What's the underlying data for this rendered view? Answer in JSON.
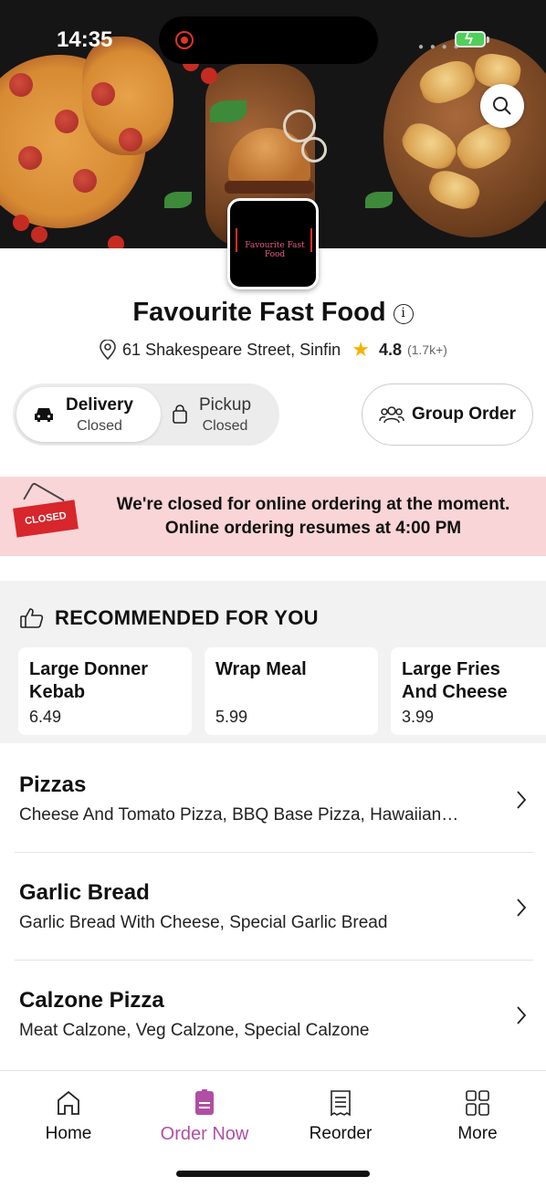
{
  "status_bar": {
    "time": "14:35"
  },
  "store": {
    "name": "Favourite Fast Food",
    "logo_text": "Favourite Fast Food",
    "address": "61 Shakespeare Street, Sinfin",
    "rating": "4.8",
    "rating_count": "(1.7k+)"
  },
  "modes": {
    "delivery": {
      "label": "Delivery",
      "status": "Closed"
    },
    "pickup": {
      "label": "Pickup",
      "status": "Closed"
    }
  },
  "group_order": {
    "label": "Group Order"
  },
  "closed_banner": {
    "sign_text": "CLOSED",
    "line1": "We're closed for online ordering at the moment.",
    "line2": "Online ordering resumes at 4:00 PM"
  },
  "recommended": {
    "title": "RECOMMENDED FOR YOU",
    "items": [
      {
        "name": "Large Donner Kebab",
        "price": "6.49"
      },
      {
        "name": "Wrap Meal",
        "price": "5.99"
      },
      {
        "name": "Large Fries And Cheese",
        "price": "3.99"
      }
    ]
  },
  "categories": [
    {
      "name": "Pizzas",
      "items": "Cheese And Tomato Pizza, BBQ Base Pizza, Hawaiian…"
    },
    {
      "name": "Garlic Bread",
      "items": "Garlic Bread With Cheese, Special Garlic Bread"
    },
    {
      "name": "Calzone Pizza",
      "items": "Meat Calzone, Veg Calzone, Special  Calzone"
    }
  ],
  "bottom_nav": [
    {
      "label": "Home",
      "icon": "home-icon"
    },
    {
      "label": "Order Now",
      "icon": "order-icon"
    },
    {
      "label": "Reorder",
      "icon": "receipt-icon"
    },
    {
      "label": "More",
      "icon": "grid-icon"
    }
  ],
  "colors": {
    "accent": "#b04fa3",
    "banner_bg": "#f9d5d7",
    "closed_red": "#d7262c",
    "star": "#f5b301"
  }
}
